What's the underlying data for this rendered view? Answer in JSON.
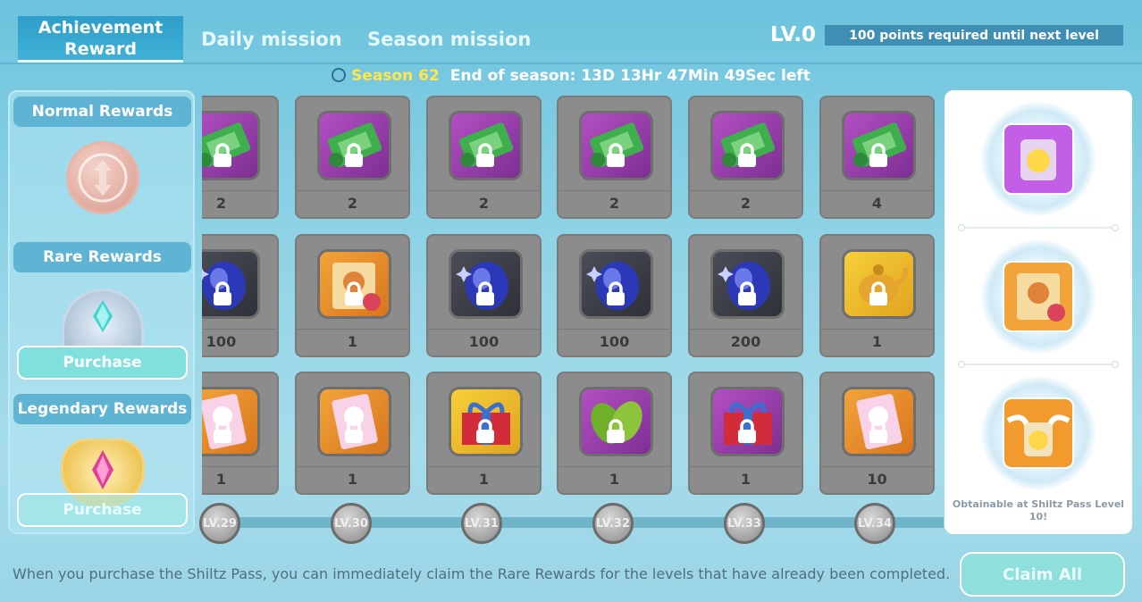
{
  "tabs": {
    "achievement_reward": "Achievement Reward",
    "daily_mission": "Daily mission",
    "season_mission": "Season mission"
  },
  "level": {
    "label": "LV.0",
    "requirement_text": "100 points required until next level"
  },
  "season": {
    "name": "Season 62",
    "end_text": "End of season: 13D 13Hr 47Min 49Sec left"
  },
  "left_panel": {
    "normal_label": "Normal Rewards",
    "rare_label": "Rare Rewards",
    "rare_purchase": "Purchase",
    "legendary_label": "Legendary Rewards",
    "legendary_purchase": "Purchase"
  },
  "levels": [
    "LV.29",
    "LV.30",
    "LV.31",
    "LV.32",
    "LV.33",
    "LV.34"
  ],
  "rows": [
    {
      "tier": "normal",
      "cells": [
        {
          "icon": "coupon-icon",
          "bg": "purple",
          "count": "2"
        },
        {
          "icon": "coupon-icon",
          "bg": "purple",
          "count": "2"
        },
        {
          "icon": "coupon-icon",
          "bg": "purple",
          "count": "2"
        },
        {
          "icon": "coupon-icon",
          "bg": "purple",
          "count": "2"
        },
        {
          "icon": "coupon-icon",
          "bg": "purple",
          "count": "2"
        },
        {
          "icon": "coupon-icon",
          "bg": "purple",
          "count": "4"
        }
      ]
    },
    {
      "tier": "rare",
      "cells": [
        {
          "icon": "blue-gem-icon",
          "bg": "dark",
          "count": "100"
        },
        {
          "icon": "scroll-icon",
          "bg": "orange",
          "count": "1"
        },
        {
          "icon": "blue-gem-icon",
          "bg": "dark",
          "count": "100"
        },
        {
          "icon": "blue-gem-icon",
          "bg": "dark",
          "count": "100"
        },
        {
          "icon": "blue-gem-icon",
          "bg": "dark",
          "count": "200"
        },
        {
          "icon": "teapot-icon",
          "bg": "yellow",
          "count": "1"
        }
      ]
    },
    {
      "tier": "legendary",
      "cells": [
        {
          "icon": "card-icon",
          "bg": "orange",
          "count": "1"
        },
        {
          "icon": "card-icon",
          "bg": "orange",
          "count": "1"
        },
        {
          "icon": "gift-box-icon",
          "bg": "yellow",
          "count": "1"
        },
        {
          "icon": "leaf-icon",
          "bg": "purple",
          "count": "1"
        },
        {
          "icon": "gift-box-icon",
          "bg": "purple",
          "count": "1"
        },
        {
          "icon": "card-icon",
          "bg": "orange",
          "count": "10"
        }
      ]
    }
  ],
  "right_panel": {
    "items": [
      {
        "icon": "jar-icon",
        "bg": "#c25fe6"
      },
      {
        "icon": "scroll-icon",
        "bg": "#f2a43a"
      },
      {
        "icon": "winged-jar-icon",
        "bg": "#f39a2e"
      }
    ],
    "caption": "Obtainable at Shiltz Pass Level 10!"
  },
  "footer": {
    "note": "When you purchase the Shiltz Pass, you can immediately claim the Rare Rewards for the levels that have already been completed.",
    "claim_all": "Claim All"
  },
  "colors": {
    "accent": "#5fb4d4",
    "season_highlight": "#ffe64a",
    "purchase_button": "#7fe0de"
  }
}
